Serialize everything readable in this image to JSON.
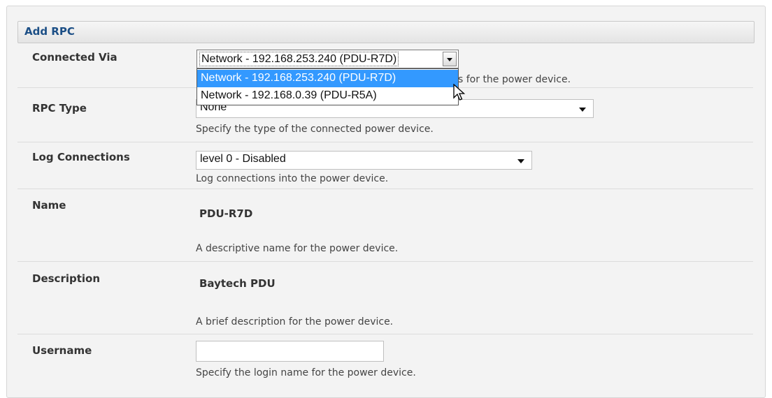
{
  "panel": {
    "title": "Add RPC"
  },
  "connected_via": {
    "label": "Connected Via",
    "selected": "Network - 192.168.253.240 (PDU-R7D)",
    "options": [
      "Network - 192.168.253.240 (PDU-R7D)",
      "Network - 192.168.0.39 (PDU-R5A)"
    ],
    "help_visible": "s for the power device."
  },
  "rpc_type": {
    "label": "RPC Type",
    "selected": "None",
    "help": "Specify the type of the connected power device."
  },
  "log_connections": {
    "label": "Log Connections",
    "selected": "level 0 - Disabled",
    "help": "Log connections into the power device."
  },
  "name": {
    "label": "Name",
    "value": "PDU-R7D",
    "help": "A descriptive name for the power device."
  },
  "description": {
    "label": "Description",
    "value": "Baytech PDU",
    "help": "A brief description for the power device."
  },
  "username": {
    "label": "Username",
    "value": "",
    "help": "Specify the login name for the power device."
  }
}
